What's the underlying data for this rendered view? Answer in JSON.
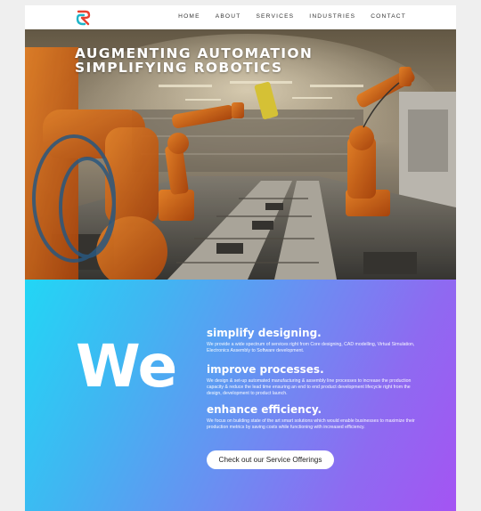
{
  "header": {
    "logo": "robot-brand-logo",
    "nav": [
      {
        "label": "HOME"
      },
      {
        "label": "ABOUT"
      },
      {
        "label": "SERVICES"
      },
      {
        "label": "INDUSTRIES"
      },
      {
        "label": "CONTACT"
      }
    ]
  },
  "hero": {
    "title_line1": "AUGMENTING AUTOMATION",
    "title_line2": "SIMPLIFYING ROBOTICS",
    "image": "industrial-robot-arms-factory"
  },
  "services": {
    "big_word": "We",
    "items": [
      {
        "heading": "simplify designing.",
        "text": "We provide a wide spectrum of services right from Core designing, CAD modelling, Virtual Simulation, Electronics Assembly to Software development."
      },
      {
        "heading": "improve processes.",
        "text": "We design & set-up automated manufacturing & assembly line processes to increase the production capacity & reduce the lead time ensuring an end to end product development lifecycle right from the design, development to product launch."
      },
      {
        "heading": "enhance efficiency.",
        "text": "We focus on building state of the art smart solutions which would enable businesses to maximize their production metrics by saving costs while functioning with increased efficiency."
      }
    ],
    "cta_label": "Check out our Service Offerings"
  },
  "colors": {
    "gradient_start": "#22d6f5",
    "gradient_end": "#a454f3",
    "robot_orange": "#e8701c",
    "logo_red": "#e8412f",
    "logo_teal": "#1fb4c8"
  }
}
